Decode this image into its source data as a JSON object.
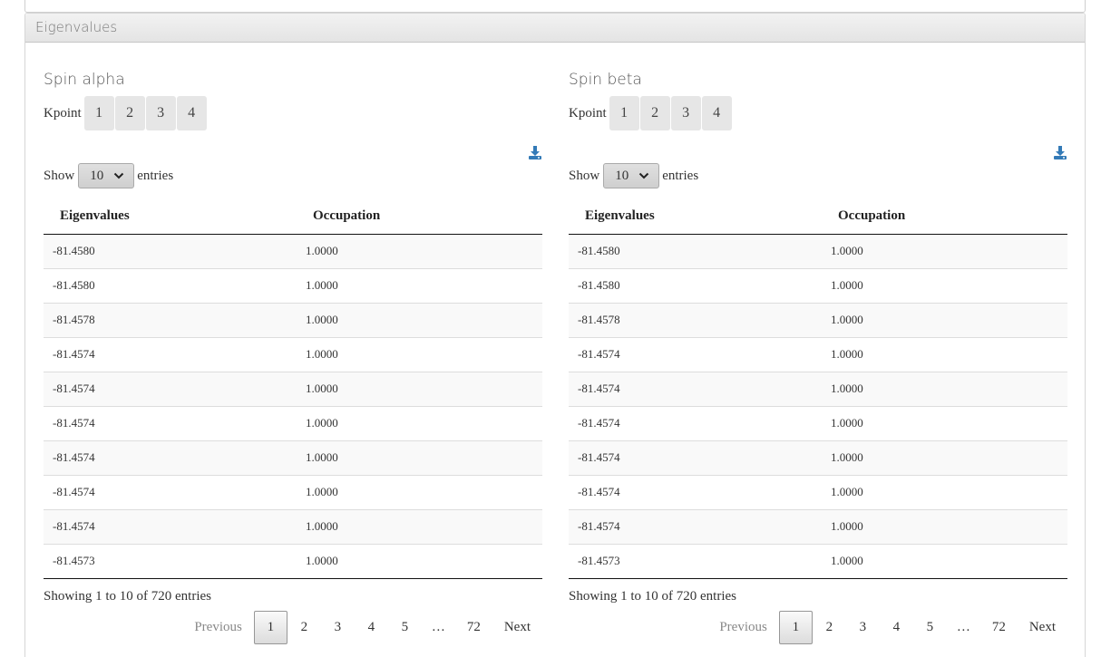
{
  "panel": {
    "title": "Eigenvalues"
  },
  "spins": [
    {
      "title": "Spin alpha",
      "kpoint_label": "Kpoint",
      "kpoints": [
        "1",
        "2",
        "3",
        "4"
      ],
      "length": {
        "show_label": "Show",
        "value": "10",
        "entries_label": "entries"
      },
      "columns": [
        "Eigenvalues",
        "Occupation"
      ],
      "rows": [
        [
          "-81.4580",
          "1.0000"
        ],
        [
          "-81.4580",
          "1.0000"
        ],
        [
          "-81.4578",
          "1.0000"
        ],
        [
          "-81.4574",
          "1.0000"
        ],
        [
          "-81.4574",
          "1.0000"
        ],
        [
          "-81.4574",
          "1.0000"
        ],
        [
          "-81.4574",
          "1.0000"
        ],
        [
          "-81.4574",
          "1.0000"
        ],
        [
          "-81.4574",
          "1.0000"
        ],
        [
          "-81.4573",
          "1.0000"
        ]
      ],
      "info": "Showing 1 to 10 of 720 entries",
      "pagination": {
        "previous": "Previous",
        "pages": [
          "1",
          "2",
          "3",
          "4",
          "5"
        ],
        "ellipsis": "…",
        "last": "72",
        "next": "Next",
        "current": "1"
      }
    },
    {
      "title": "Spin beta",
      "kpoint_label": "Kpoint",
      "kpoints": [
        "1",
        "2",
        "3",
        "4"
      ],
      "length": {
        "show_label": "Show",
        "value": "10",
        "entries_label": "entries"
      },
      "columns": [
        "Eigenvalues",
        "Occupation"
      ],
      "rows": [
        [
          "-81.4580",
          "1.0000"
        ],
        [
          "-81.4580",
          "1.0000"
        ],
        [
          "-81.4578",
          "1.0000"
        ],
        [
          "-81.4574",
          "1.0000"
        ],
        [
          "-81.4574",
          "1.0000"
        ],
        [
          "-81.4574",
          "1.0000"
        ],
        [
          "-81.4574",
          "1.0000"
        ],
        [
          "-81.4574",
          "1.0000"
        ],
        [
          "-81.4574",
          "1.0000"
        ],
        [
          "-81.4573",
          "1.0000"
        ]
      ],
      "info": "Showing 1 to 10 of 720 entries",
      "pagination": {
        "previous": "Previous",
        "pages": [
          "1",
          "2",
          "3",
          "4",
          "5"
        ],
        "ellipsis": "…",
        "last": "72",
        "next": "Next",
        "current": "1"
      }
    }
  ],
  "colors": {
    "accent": "#337ab7",
    "panel_heading_text": "#777777"
  },
  "icons": {
    "download": "download-icon",
    "select_arrow": "chevron-down-icon"
  }
}
